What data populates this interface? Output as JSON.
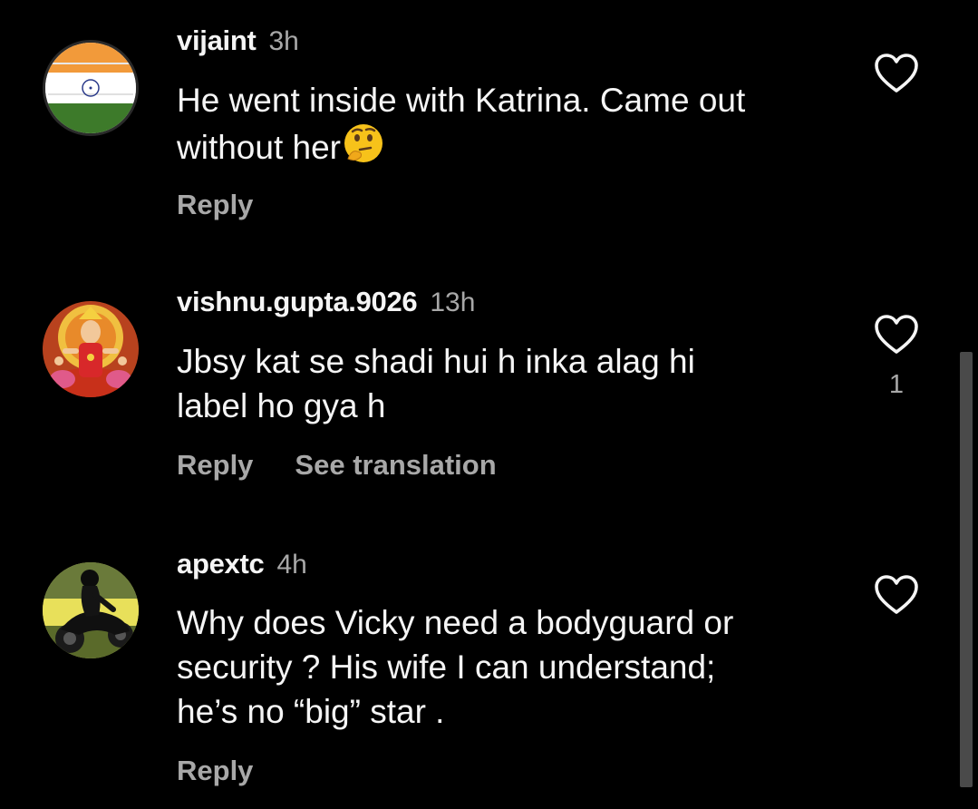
{
  "comments": [
    {
      "username": "vijaint",
      "time": "3h",
      "line1": "He went inside with Katrina. Came out",
      "line2": "without her",
      "reply_label": "Reply",
      "like_count": ""
    },
    {
      "username": "vishnu.gupta.9026",
      "time": "13h",
      "line1": "Jbsy kat se shadi hui h inka alag hi",
      "line2": "label ho gya h",
      "reply_label": "Reply",
      "translate_label": "See translation",
      "like_count": "1"
    },
    {
      "username": "apextc",
      "time": "4h",
      "line1": "Why does Vicky need a bodyguard or",
      "line2": "security ? His wife I can understand;",
      "line3": "he’s no “big” star .",
      "reply_label": "Reply",
      "like_count": ""
    }
  ],
  "icons": {
    "like": "heart-outline-icon",
    "emoji": "thinking-face-emoji"
  },
  "colors": {
    "background": "#000000",
    "text_primary": "#f5f5f5",
    "text_secondary": "#a8a8a8"
  }
}
